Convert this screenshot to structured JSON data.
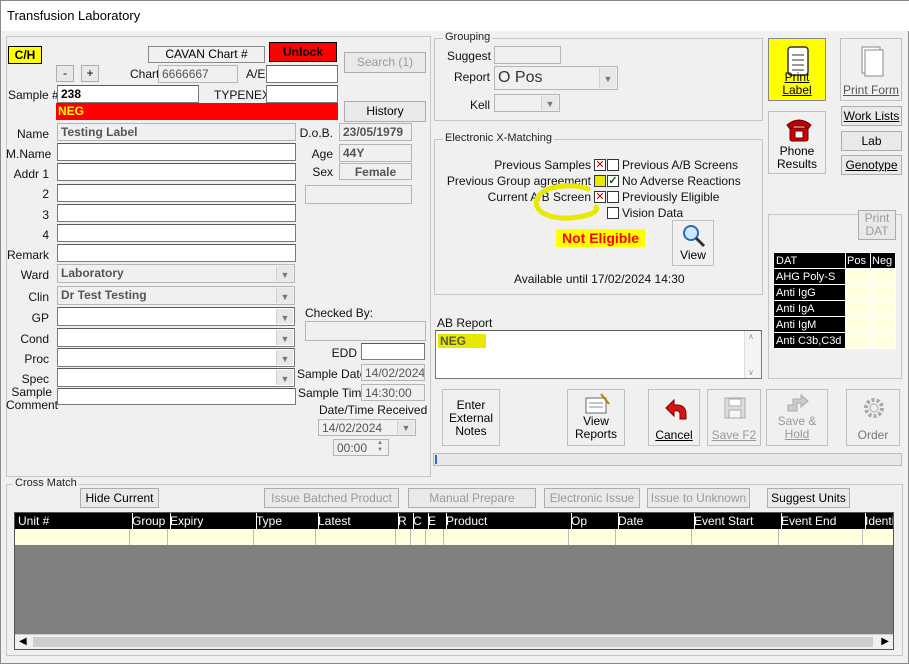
{
  "window": {
    "title": "Transfusion Laboratory"
  },
  "patient": {
    "site_badge": "C/H",
    "chart_label": "CAVAN Chart #",
    "unlock_label": "Unlock",
    "search_label": "Search (1)",
    "minus_label": "-",
    "plus_label": "+",
    "chart_field_label": "Chart",
    "chart_value": "6666667",
    "ae_label": "A/E",
    "ae_value": "",
    "sample_label": "Sample #",
    "sample_value": "238",
    "typenex_label": "TYPENEX",
    "typenex_value": "",
    "neg_banner": "NEG",
    "history_label": "History",
    "name_label": "Name",
    "name_value": "Testing Label",
    "mname_label": "M.Name",
    "addr1_label": "Addr 1",
    "addr2_label": "2",
    "addr3_label": "3",
    "addr4_label": "4",
    "remark_label": "Remark",
    "ward_label": "Ward",
    "ward_value": "Laboratory",
    "clin_label": "Clin",
    "clin_value": "Dr Test Testing",
    "gp_label": "GP",
    "cond_label": "Cond",
    "proc_label": "Proc",
    "spec_label": "Spec",
    "sample_comment_label_1": "Sample",
    "sample_comment_label_2": "Comment",
    "dob_label": "D.o.B.",
    "dob_value": "23/05/1979",
    "age_label": "Age",
    "age_value": "44Y",
    "sex_label": "Sex",
    "sex_value": "Female",
    "checked_by_label": "Checked By:",
    "edd_label": "EDD",
    "sample_date_label": "Sample Date",
    "sample_date_value": "14/02/2024",
    "sample_time_label": "Sample Time",
    "sample_time_value": "14:30:00",
    "received_label": "Date/Time Received",
    "received_date_value": "14/02/2024",
    "received_time_value": "00:00"
  },
  "grouping": {
    "title": "Grouping",
    "suggest_label": "Suggest",
    "report_label": "Report",
    "report_value": "O Pos",
    "kell_label": "Kell"
  },
  "exm": {
    "title": "Electronic X-Matching",
    "previous_samples": "Previous Samples",
    "previous_group_agreement": "Previous Group agreement",
    "current_ab_screen": "Current A/B Screen",
    "previous_ab_screens": "Previous A/B Screens",
    "no_adverse_reactions": "No Adverse Reactions",
    "previously_eligible": "Previously Eligible",
    "vision_data": "Vision Data",
    "status": "Not Eligible",
    "view_label": "View",
    "available_until": "Available until 17/02/2024 14:30",
    "mark_x": "✕",
    "mark_check": "✓"
  },
  "ab_report": {
    "label": "AB Report",
    "value": "NEG"
  },
  "right_buttons": {
    "print_label": "Print Label",
    "print_form": "Print Form",
    "phone_results_1": "Phone",
    "phone_results_2": "Results",
    "work_lists": "Work Lists",
    "lab": "Lab",
    "genotype": "Genotype",
    "print_dat_1": "Print",
    "print_dat_2": "DAT"
  },
  "dat_table": {
    "headers": [
      "DAT",
      "Pos",
      "Neg"
    ],
    "rows": [
      "AHG Poly-S",
      "Anti IgG",
      "Anti IgA",
      "Anti IgM",
      "Anti C3b,C3d"
    ]
  },
  "actions": {
    "external_notes_1": "Enter",
    "external_notes_2": "External",
    "external_notes_3": "Notes",
    "view_reports_1": "View",
    "view_reports_2": "Reports",
    "cancel": "Cancel",
    "save": "Save F2",
    "save_hold_1": "Save &",
    "save_hold_2": "Hold",
    "order": "Order"
  },
  "crossmatch": {
    "title": "Cross Match",
    "hide_current": "Hide Current",
    "issue_batched": "Issue Batched Product",
    "manual_prepare": "Manual Prepare",
    "electronic_issue": "Electronic Issue",
    "issue_unknown": "Issue to Unknown",
    "suggest_units": "Suggest Units",
    "columns": [
      "Unit #",
      "Group",
      "Expiry",
      "Type",
      "Latest",
      "R",
      "C",
      "E",
      "Product",
      "Op",
      "Date",
      "Event Start",
      "Event End",
      "Identi"
    ]
  },
  "colors": {
    "yellow": "#ffff00",
    "red": "#ff0000",
    "highlight": "#e8e800",
    "grid_bg": "#808080"
  }
}
